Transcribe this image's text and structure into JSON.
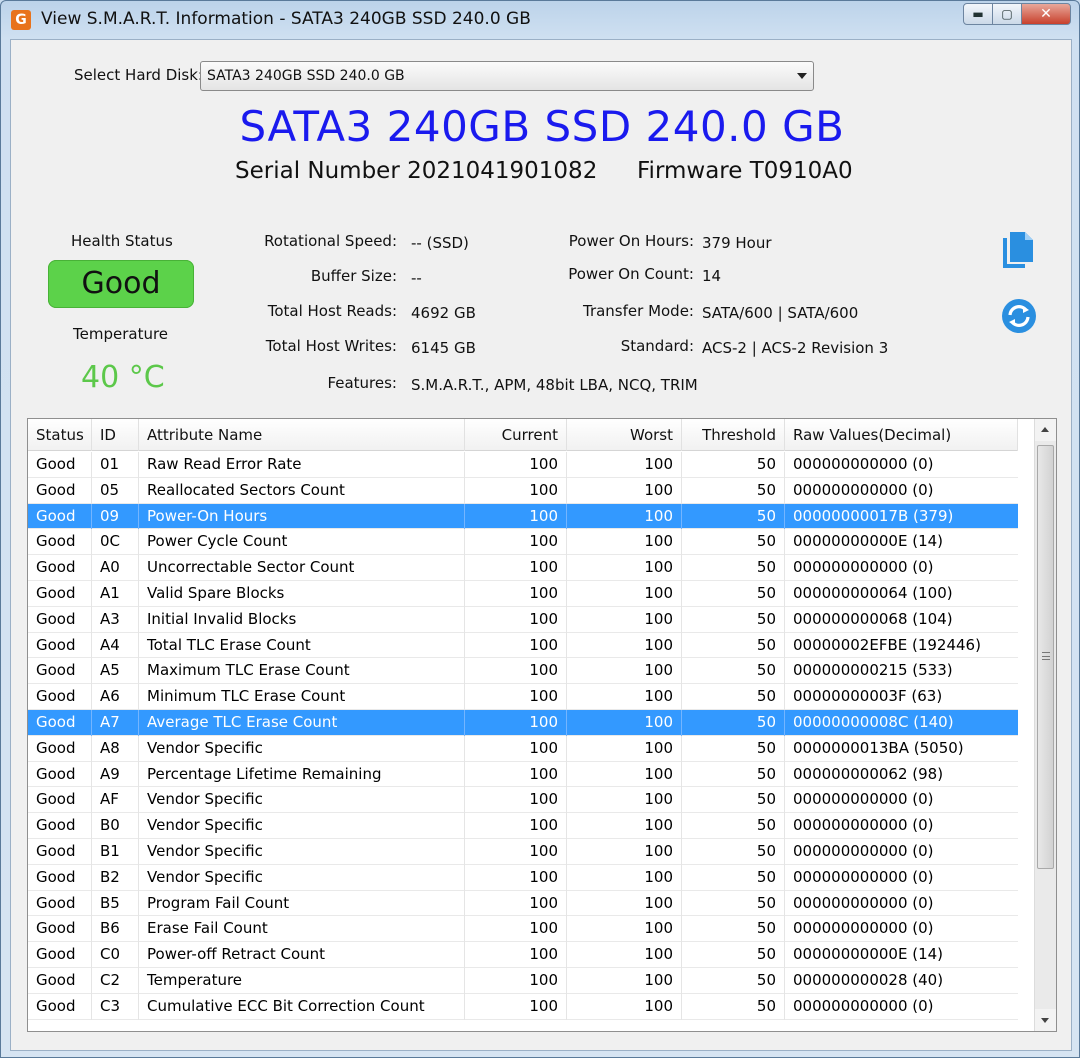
{
  "window": {
    "title": "View S.M.A.R.T. Information - SATA3 240GB SSD 240.0 GB",
    "app_icon": "G",
    "buttons": {
      "minimize": "▬",
      "maximize": "▢",
      "close": "✕"
    }
  },
  "disk_select": {
    "label": "Select Hard Disk:",
    "value": "SATA3 240GB SSD 240.0 GB"
  },
  "disk": {
    "title": "SATA3 240GB SSD 240.0 GB",
    "serial": "Serial Number 2021041901082",
    "firmware": "Firmware T0910A0"
  },
  "health": {
    "label": "Health Status",
    "value": "Good",
    "color": "#5cd24a"
  },
  "temperature": {
    "label": "Temperature",
    "value": "40 °C",
    "color": "#5cc84a"
  },
  "info": {
    "rotational_speed": {
      "label": "Rotational Speed:",
      "value": "-- (SSD)"
    },
    "buffer_size": {
      "label": "Buffer Size:",
      "value": "--"
    },
    "total_host_reads": {
      "label": "Total Host Reads:",
      "value": "4692 GB"
    },
    "total_host_writes": {
      "label": "Total Host Writes:",
      "value": "6145 GB"
    },
    "features": {
      "label": "Features:",
      "value": "S.M.A.R.T., APM, 48bit LBA, NCQ, TRIM"
    },
    "power_on_hours": {
      "label": "Power On Hours:",
      "value": "379 Hour"
    },
    "power_on_count": {
      "label": "Power On Count:",
      "value": "14"
    },
    "transfer_mode": {
      "label": "Transfer Mode:",
      "value": "SATA/600 | SATA/600"
    },
    "standard": {
      "label": "Standard:",
      "value": "ACS-2 | ACS-2 Revision 3"
    }
  },
  "icons": {
    "copy": "copy-icon",
    "refresh": "refresh-icon",
    "accent": "#2a8fe0"
  },
  "table": {
    "columns": [
      "Status",
      "ID",
      "Attribute Name",
      "Current",
      "Worst",
      "Threshold",
      "Raw Values(Decimal)"
    ],
    "rows": [
      [
        "Good",
        "01",
        "Raw Read Error Rate",
        "100",
        "100",
        "50",
        "000000000000 (0)"
      ],
      [
        "Good",
        "05",
        "Reallocated Sectors Count",
        "100",
        "100",
        "50",
        "000000000000 (0)"
      ],
      [
        "Good",
        "09",
        "Power-On Hours",
        "100",
        "100",
        "50",
        "00000000017B (379)"
      ],
      [
        "Good",
        "0C",
        "Power Cycle Count",
        "100",
        "100",
        "50",
        "00000000000E (14)"
      ],
      [
        "Good",
        "A0",
        "Uncorrectable Sector Count",
        "100",
        "100",
        "50",
        "000000000000 (0)"
      ],
      [
        "Good",
        "A1",
        "Valid Spare Blocks",
        "100",
        "100",
        "50",
        "000000000064 (100)"
      ],
      [
        "Good",
        "A3",
        "Initial Invalid Blocks",
        "100",
        "100",
        "50",
        "000000000068 (104)"
      ],
      [
        "Good",
        "A4",
        "Total TLC Erase Count",
        "100",
        "100",
        "50",
        "00000002EFBE (192446)"
      ],
      [
        "Good",
        "A5",
        "Maximum TLC Erase Count",
        "100",
        "100",
        "50",
        "000000000215 (533)"
      ],
      [
        "Good",
        "A6",
        "Minimum TLC Erase Count",
        "100",
        "100",
        "50",
        "00000000003F (63)"
      ],
      [
        "Good",
        "A7",
        "Average TLC Erase Count",
        "100",
        "100",
        "50",
        "00000000008C (140)"
      ],
      [
        "Good",
        "A8",
        "Vendor Specific",
        "100",
        "100",
        "50",
        "0000000013BA (5050)"
      ],
      [
        "Good",
        "A9",
        "Percentage Lifetime Remaining",
        "100",
        "100",
        "50",
        "000000000062 (98)"
      ],
      [
        "Good",
        "AF",
        "Vendor Specific",
        "100",
        "100",
        "50",
        "000000000000 (0)"
      ],
      [
        "Good",
        "B0",
        "Vendor Specific",
        "100",
        "100",
        "50",
        "000000000000 (0)"
      ],
      [
        "Good",
        "B1",
        "Vendor Specific",
        "100",
        "100",
        "50",
        "000000000000 (0)"
      ],
      [
        "Good",
        "B2",
        "Vendor Specific",
        "100",
        "100",
        "50",
        "000000000000 (0)"
      ],
      [
        "Good",
        "B5",
        "Program Fail Count",
        "100",
        "100",
        "50",
        "000000000000 (0)"
      ],
      [
        "Good",
        "B6",
        "Erase Fail Count",
        "100",
        "100",
        "50",
        "000000000000 (0)"
      ],
      [
        "Good",
        "C0",
        "Power-off Retract Count",
        "100",
        "100",
        "50",
        "00000000000E (14)"
      ],
      [
        "Good",
        "C2",
        "Temperature",
        "100",
        "100",
        "50",
        "000000000028 (40)"
      ],
      [
        "Good",
        "C3",
        "Cumulative ECC Bit Correction Count",
        "100",
        "100",
        "50",
        "000000000000 (0)"
      ]
    ],
    "selected_rows": [
      2,
      10
    ],
    "selection_color": "#3399ff"
  }
}
